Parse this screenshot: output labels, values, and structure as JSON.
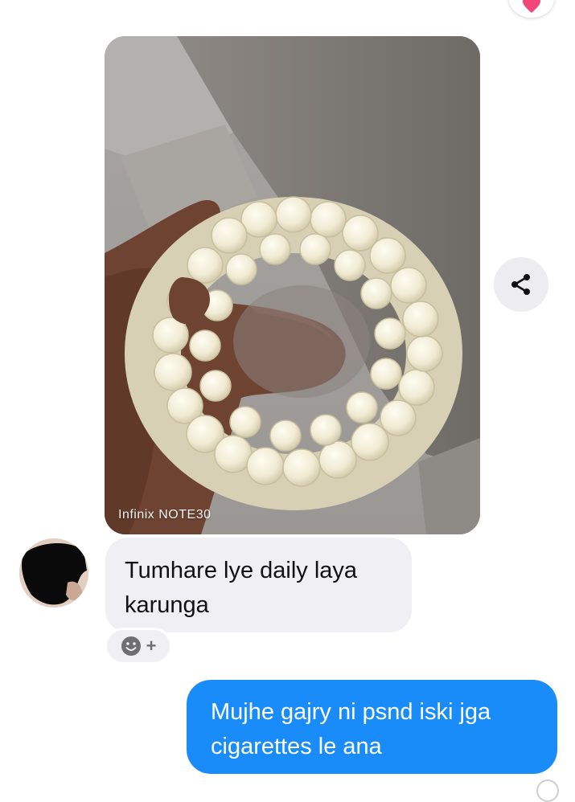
{
  "top_reaction": {
    "icon": "heart-icon",
    "color": "#f0467a"
  },
  "photo": {
    "description_icon": "jasmine-flower-bracelet-photo",
    "watermark": "Infinix NOTE30"
  },
  "share_button": {
    "icon": "share-icon"
  },
  "incoming_message": {
    "avatar_icon": "contact-avatar",
    "line1": "Tumhare lye daily laya",
    "line2": "karunga"
  },
  "reaction_picker": {
    "icon": "smiley-icon",
    "plus": "+"
  },
  "outgoing_message": {
    "line1": "Mujhe gajry ni psnd iski jga",
    "line2": "cigarettes le ana",
    "color": "#1a8cf9"
  }
}
